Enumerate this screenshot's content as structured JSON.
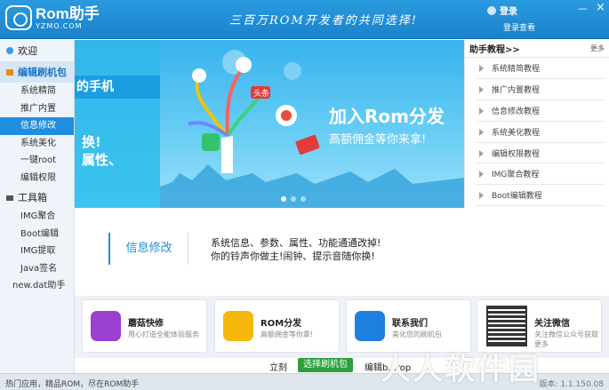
{
  "app": {
    "logo_name": "Rom助手",
    "logo_url": "YZMO.COM",
    "slogan": "三百万ROM开发者的共同选择!",
    "login_label": "登录",
    "login_sub": "登录查看",
    "min_glyph": "—",
    "close_glyph": "×"
  },
  "sidebar": {
    "welcome": "欢迎",
    "edit_section": "编辑刷机包",
    "edit_items": [
      "系统精简",
      "推广内置",
      "信息修改",
      "系统美化",
      "一键root",
      "编辑权限"
    ],
    "selected_index": 2,
    "tools_section": "工具箱",
    "tool_items": [
      "IMG聚合",
      "Boot编辑",
      "IMG提取",
      "Java签名",
      "new.dat助手"
    ]
  },
  "banner": {
    "left_tab": "的手机",
    "left_line1": "换!",
    "left_line2": "属性、",
    "slogan_main": "加入Rom分发",
    "slogan_sub": "高额佣金等你来拿!",
    "badge_text": "头条"
  },
  "tutorials": {
    "title": "助手教程>>",
    "more": "更多",
    "items": [
      "系统精简教程",
      "推广内置教程",
      "信息修改教程",
      "系统美化教程",
      "编辑权限教程",
      "IMG聚合教程",
      "Boot编辑教程"
    ]
  },
  "info": {
    "label": "信息修改",
    "line1": "系统信息、参数、属性、功能通通改掉!",
    "line2": "你的铃声你做主!闹钟、提示音随你换!"
  },
  "cards": [
    {
      "title": "蘑菇快修",
      "sub": "用心打造全能体验服务",
      "color": "#9b3fd0"
    },
    {
      "title": "ROM分发",
      "sub": "高额佣金等你拿!",
      "color": "#f5b70c"
    },
    {
      "title": "联系我们",
      "sub": "美化您的刷机包",
      "color": "#1d7fe0"
    },
    {
      "title": "关注微信",
      "sub": "关注微信公众号获取更多",
      "color": "#222222"
    }
  ],
  "actionbar": {
    "prefix": "立刻",
    "button": "选择刷机包",
    "suffix": "编辑b...rop"
  },
  "status": {
    "text": "热门应用，精品ROM，尽在ROM助手",
    "version": "版本: 1.1.150.08"
  },
  "watermark": "人人软件园",
  "colors": {
    "accent": "#1f8ee0",
    "titlebar": "#2a9be0",
    "go_button": "#2aa13a"
  }
}
